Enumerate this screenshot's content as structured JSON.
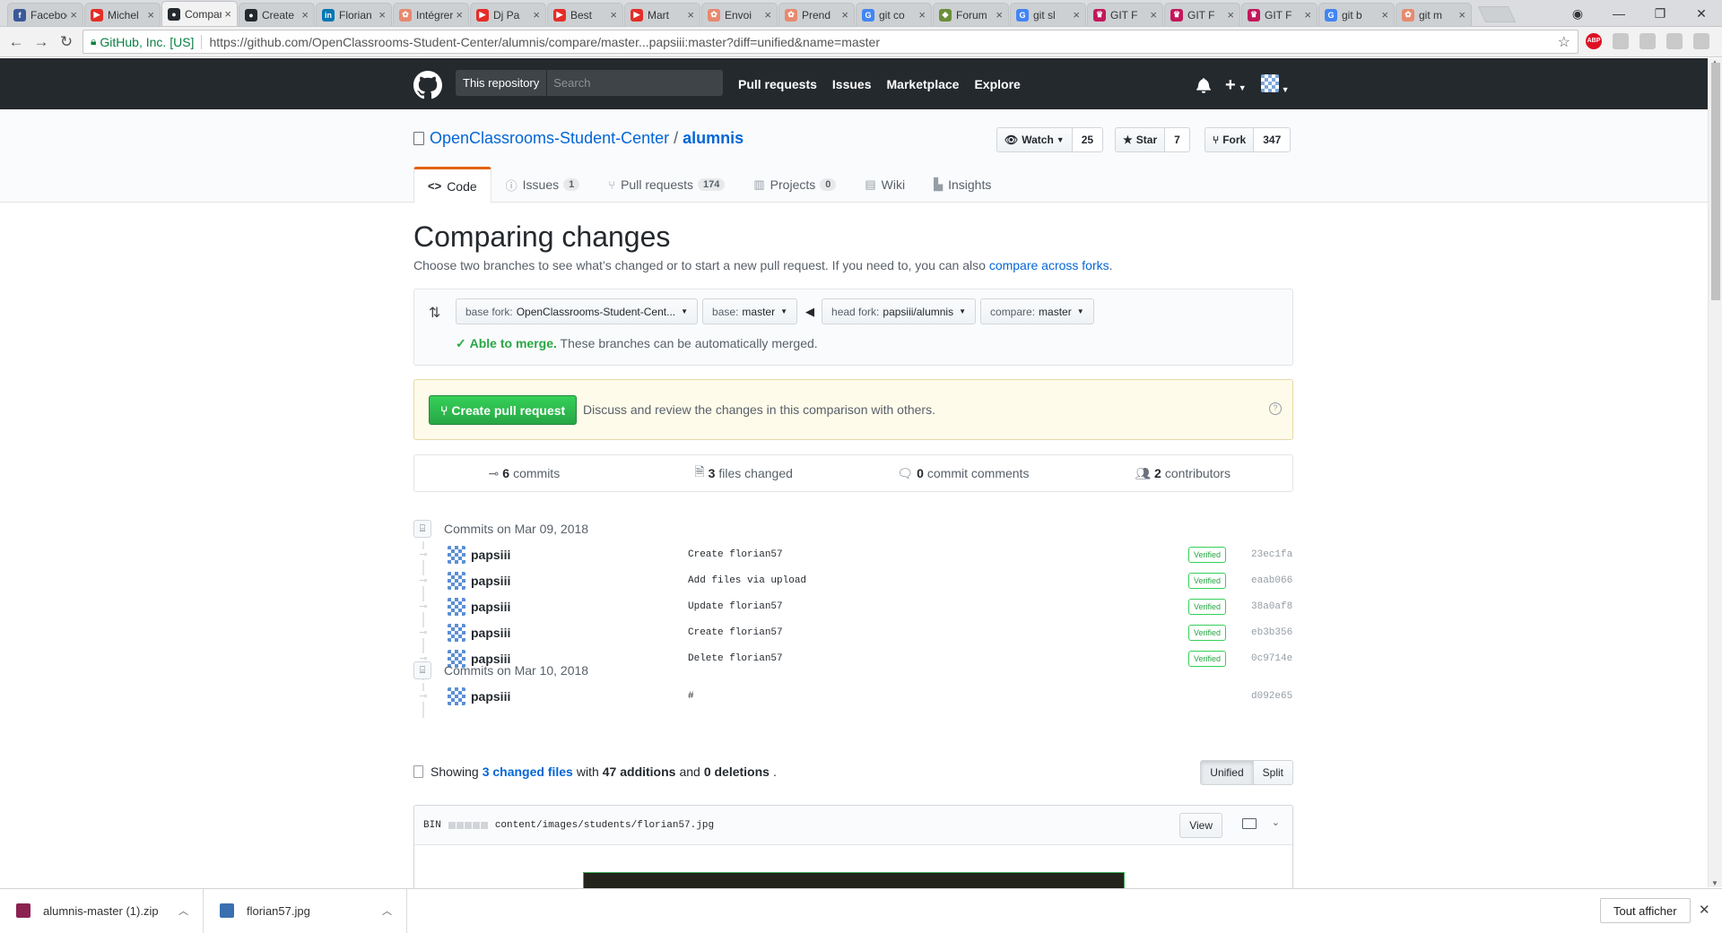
{
  "browser": {
    "tabs": [
      {
        "title": "Facebook",
        "icon": "facebook-icon",
        "color": "#3b5998",
        "glyph": "f"
      },
      {
        "title": "Michel",
        "icon": "youtube-icon",
        "color": "#e52d27",
        "glyph": "▶"
      },
      {
        "title": "Comparing changes",
        "icon": "github-icon",
        "color": "#24292e",
        "glyph": "●",
        "active": true
      },
      {
        "title": "Create",
        "icon": "github-icon",
        "color": "#24292e",
        "glyph": "●"
      },
      {
        "title": "Florian",
        "icon": "linkedin-icon",
        "color": "#0077b5",
        "glyph": "in"
      },
      {
        "title": "Intégrer",
        "icon": "openclassrooms-icon",
        "color": "#e7896e",
        "glyph": "✿"
      },
      {
        "title": "Dj Pa",
        "icon": "youtube-icon",
        "color": "#e52d27",
        "glyph": "▶"
      },
      {
        "title": "Best",
        "icon": "youtube-icon",
        "color": "#e52d27",
        "glyph": "▶"
      },
      {
        "title": "Mart",
        "icon": "youtube-icon",
        "color": "#e52d27",
        "glyph": "▶"
      },
      {
        "title": "Envoi",
        "icon": "openclassrooms-icon",
        "color": "#e7896e",
        "glyph": "✿"
      },
      {
        "title": "Prend",
        "icon": "openclassrooms-icon",
        "color": "#e7896e",
        "glyph": "✿"
      },
      {
        "title": "git co",
        "icon": "google-icon",
        "color": "#4285f4",
        "glyph": "G"
      },
      {
        "title": "Forum",
        "icon": "forum-icon",
        "color": "#6a8f3a",
        "glyph": "◆"
      },
      {
        "title": "git sl",
        "icon": "google-icon",
        "color": "#4285f4",
        "glyph": "G"
      },
      {
        "title": "GIT F",
        "icon": "crown-icon",
        "color": "#c2185b",
        "glyph": "♛"
      },
      {
        "title": "GIT F",
        "icon": "crown-icon",
        "color": "#c2185b",
        "glyph": "♛"
      },
      {
        "title": "GIT F",
        "icon": "crown-icon",
        "color": "#c2185b",
        "glyph": "♛"
      },
      {
        "title": "git b",
        "icon": "google-icon",
        "color": "#4285f4",
        "glyph": "G"
      },
      {
        "title": "git m",
        "icon": "openclassrooms-icon",
        "color": "#e7896e",
        "glyph": "✿"
      }
    ],
    "secure_label": "GitHub, Inc. [US]",
    "url": "https://github.com/OpenClassrooms-Student-Center/alumnis/compare/master...papsiii:master?diff=unified&name=master"
  },
  "gh": {
    "search_scope": "This repository",
    "search_placeholder": "Search",
    "nav": [
      "Pull requests",
      "Issues",
      "Marketplace",
      "Explore"
    ]
  },
  "repo": {
    "owner": "OpenClassrooms-Student-Center",
    "separator": "/",
    "name": "alumnis",
    "watch_label": "Watch",
    "watch_count": "25",
    "star_label": "Star",
    "star_count": "7",
    "fork_label": "Fork",
    "fork_count": "347",
    "tabs": [
      {
        "label": "Code",
        "icon": "code-icon",
        "glyph": "<>",
        "counter": ""
      },
      {
        "label": "Issues",
        "icon": "issue-icon",
        "glyph": "ⓘ",
        "counter": "1"
      },
      {
        "label": "Pull requests",
        "icon": "pull-request-icon",
        "glyph": "⑂",
        "counter": "174"
      },
      {
        "label": "Projects",
        "icon": "project-icon",
        "glyph": "▥",
        "counter": "0"
      },
      {
        "label": "Wiki",
        "icon": "book-icon",
        "glyph": "▤",
        "counter": ""
      },
      {
        "label": "Insights",
        "icon": "graph-icon",
        "glyph": "▙",
        "counter": ""
      }
    ]
  },
  "compare": {
    "title": "Comparing changes",
    "lead": "Choose two branches to see what’s changed or to start a new pull request. If you need to, you can also",
    "lead_link": "compare across forks",
    "lead_end": ".",
    "base_fork_label": "base fork:",
    "base_fork_value": "OpenClassrooms-Student-Cent...",
    "base_label": "base:",
    "base_value": "master",
    "head_fork_label": "head fork:",
    "head_fork_value": "papsiii/alumnis",
    "compare_label": "compare:",
    "compare_value": "master",
    "merge_ok": "Able to merge.",
    "merge_text": "These branches can be automatically merged.",
    "create_pr": "Create pull request",
    "create_pr_desc": "Discuss and review the changes in this comparison with others.",
    "numbers": {
      "commits_count": "6",
      "commits_label": "commits",
      "files_count": "3",
      "files_label": "files changed",
      "comments_count": "0",
      "comments_label": "commit comments",
      "contributors_count": "2",
      "contributors_label": "contributors"
    },
    "groups": [
      {
        "date": "Commits on Mar 09, 2018",
        "commits": [
          {
            "author": "papsiii",
            "message": "Create florian57",
            "verified": "Verified",
            "sha": "23ec1fa"
          },
          {
            "author": "papsiii",
            "message": "Add files via upload",
            "verified": "Verified",
            "sha": "eaab066"
          },
          {
            "author": "papsiii",
            "message": "Update florian57",
            "verified": "Verified",
            "sha": "38a0af8"
          },
          {
            "author": "papsiii",
            "message": "Create florian57",
            "verified": "Verified",
            "sha": "eb3b356"
          },
          {
            "author": "papsiii",
            "message": "Delete florian57",
            "verified": "Verified",
            "sha": "0c9714e"
          }
        ]
      },
      {
        "date": "Commits on Mar 10, 2018",
        "commits": [
          {
            "author": "papsiii",
            "message": "#",
            "verified": "",
            "sha": "d092e65"
          }
        ]
      }
    ],
    "summary": {
      "showing": "Showing",
      "changed_files": "3 changed files",
      "with": "with",
      "additions": "47 additions",
      "and": "and",
      "deletions": "0 deletions",
      "end": "."
    },
    "unified": "Unified",
    "split": "Split",
    "file": {
      "type": "BIN",
      "path": "content/images/students/florian57.jpg",
      "view": "View"
    }
  },
  "downloads": [
    {
      "name": "alumnis-master (1).zip",
      "icon": "archive-icon",
      "color": "#8b2252"
    },
    {
      "name": "florian57.jpg",
      "icon": "image-file-icon",
      "color": "#3a6fb0"
    }
  ],
  "shelf_show_all": "Tout afficher"
}
